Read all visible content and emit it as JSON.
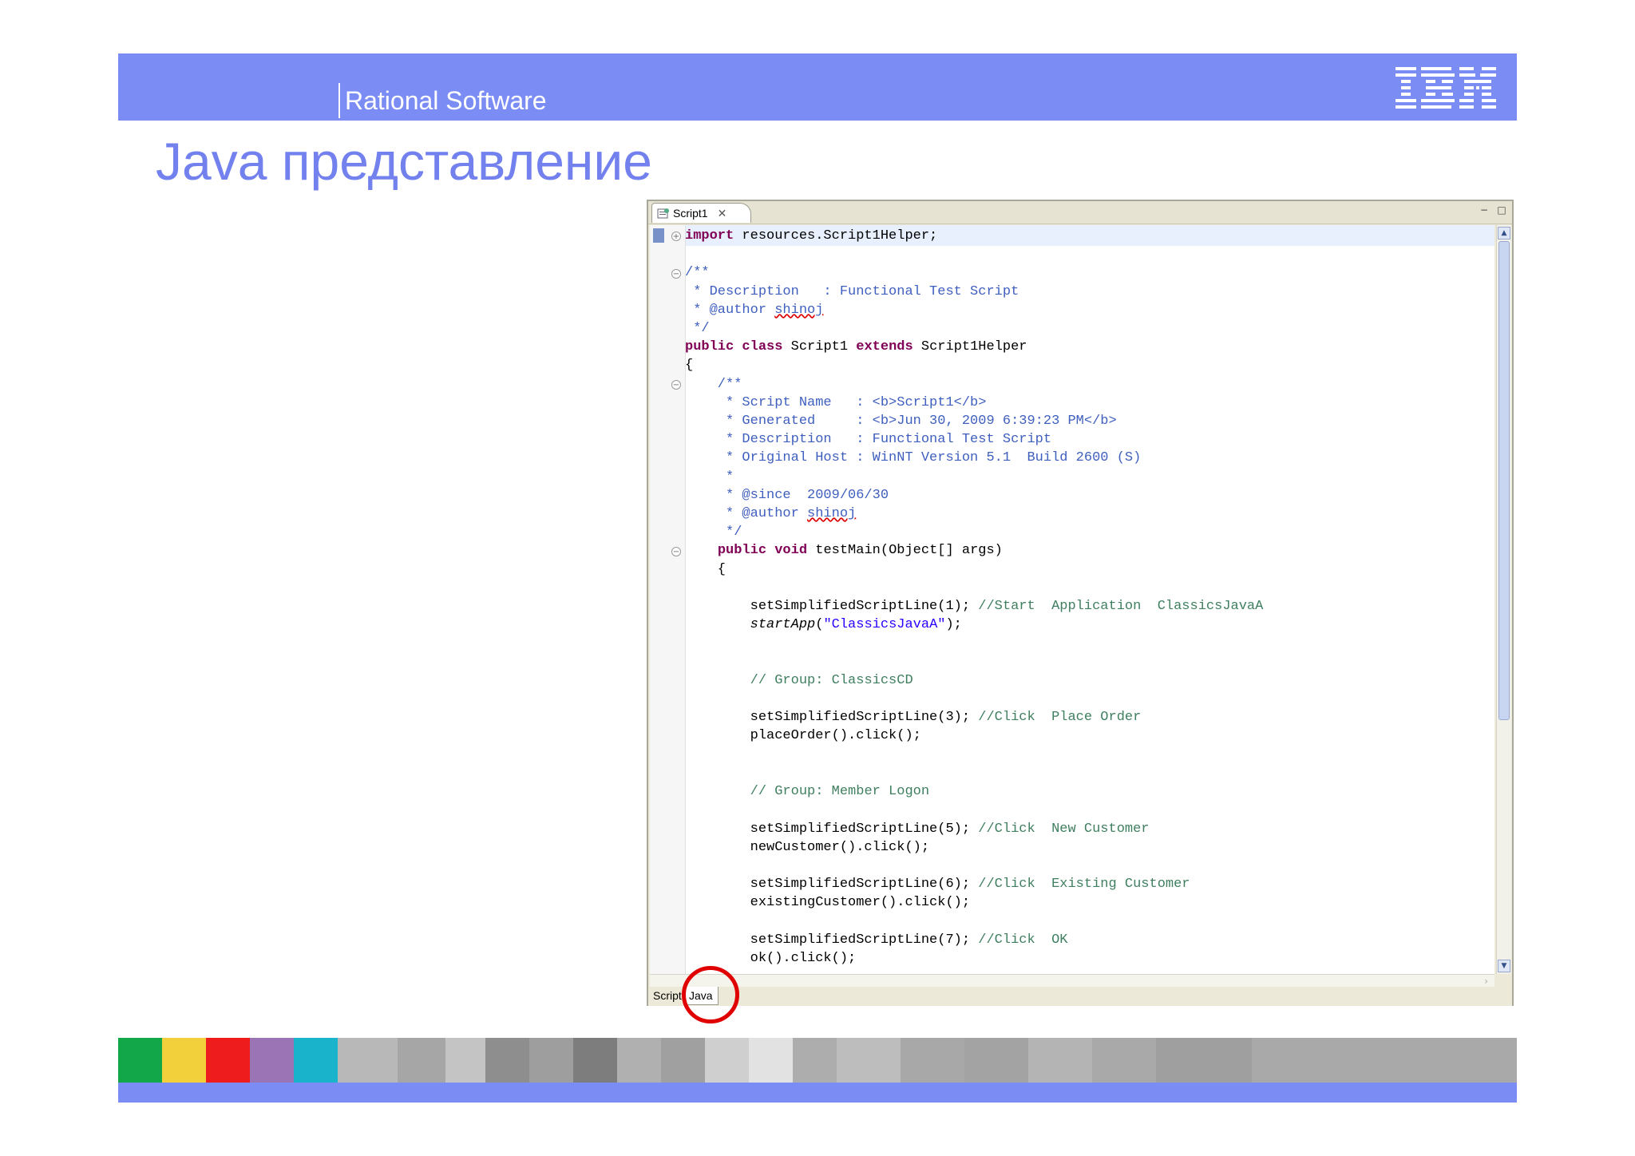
{
  "header": {
    "brand": "Rational Software",
    "logo_text": "IBM",
    "title": "Java представление"
  },
  "editor": {
    "tab_label": "Script1",
    "tab_close": "✕",
    "minimize": "−",
    "maximize": "□",
    "bottom_tabs": [
      "Script",
      "Java"
    ],
    "active_bottom_tab": "Java"
  },
  "code_lines": [
    "import resources.Script1Helper;",
    "",
    "/**",
    " * Description   : Functional Test Script",
    " * @author shinoj",
    " */",
    "public class Script1 extends Script1Helper",
    "{",
    "    /**",
    "     * Script Name   : <b>Script1</b>",
    "     * Generated     : <b>Jun 30, 2009 6:39:23 PM</b>",
    "     * Description   : Functional Test Script",
    "     * Original Host : WinNT Version 5.1  Build 2600 (S)",
    "     *",
    "     * @since  2009/06/30",
    "     * @author shinoj",
    "     */",
    "    public void testMain(Object[] args)",
    "    {",
    "",
    "        setSimplifiedScriptLine(1); //Start  Application  ClassicsJavaA",
    "        startApp(\"ClassicsJavaA\");",
    "",
    "",
    "        // Group: ClassicsCD",
    "",
    "        setSimplifiedScriptLine(3); //Click  Place Order",
    "        placeOrder().click();",
    "",
    "",
    "        // Group: Member Logon",
    "",
    "        setSimplifiedScriptLine(5); //Click  New Customer",
    "        newCustomer().click();",
    "",
    "        setSimplifiedScriptLine(6); //Click  Existing Customer",
    "        existingCustomer().click();",
    "",
    "        setSimplifiedScriptLine(7); //Click  OK",
    "        ok().click();"
  ],
  "colors": {
    "banner": "#7b8cf5",
    "title": "#7281ee",
    "keyword": "#7f0055",
    "javadoc": "#3f5fbf",
    "line_comment": "#3f7f5f",
    "string": "#2a00ff",
    "highlight_circle": "#e00000"
  },
  "strip_colors": [
    "#12a84a",
    "#f2d03c",
    "#ee1c1c",
    "#9a74b4",
    "#1ab3cc",
    "#b8b8b8",
    "#a6a6a6",
    "#c4c4c4",
    "#8e8e8e",
    "#9e9e9e",
    "#7d7d7d",
    "#b0b0b0",
    "#a0a0a0",
    "#cfcfcf",
    "#e2e2e2",
    "#adadad",
    "#bdbdbd",
    "#a8a8a8",
    "#a3a3a3",
    "#b4b4b4",
    "#a9a9a9",
    "#9f9f9f"
  ]
}
